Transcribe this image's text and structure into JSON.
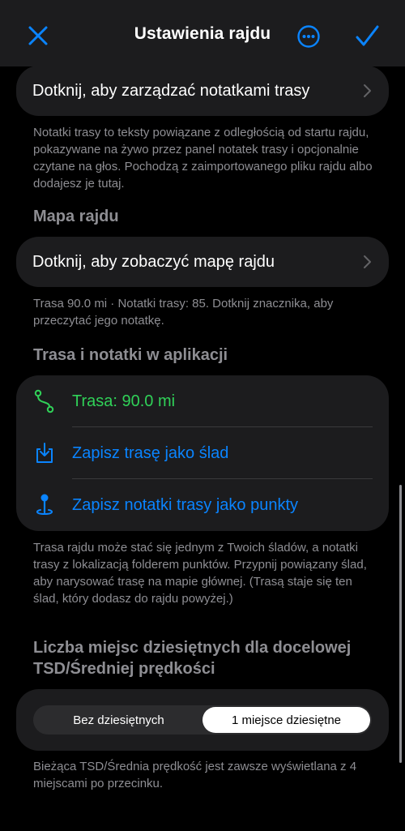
{
  "nav": {
    "title": "Ustawienia rajdu"
  },
  "route_notes": {
    "link_label": "Dotknij, aby zarządzać notatkami trasy",
    "footnote": "Notatki trasy to teksty powiązane z odległością od startu rajdu, pokazywane na żywo przez panel notatek trasy i opcjonalnie czytane na głos. Pochodzą z zaimportowanego pliku rajdu albo dodajesz je tutaj."
  },
  "map": {
    "header": "Mapa rajdu",
    "link_label": "Dotknij, aby zobaczyć mapę rajdu",
    "footnote": "Trasa 90.0 mi · Notatki trasy: 85. Dotknij znacznika, aby przeczytać jego notatkę."
  },
  "app_route": {
    "header": "Trasa i notatki w aplikacji",
    "route_label": "Trasa: 90.0 mi",
    "save_track_label": "Zapisz trasę jako ślad",
    "save_points_label": "Zapisz notatki trasy jako punkty",
    "footnote": "Trasa rajdu może stać się jednym z Twoich śladów, a notatki trasy z lokalizacją folderem punktów. Przypnij powiązany ślad, aby narysować trasę na mapie głównej. (Trasą staje się ten ślad, który dodasz do rajdu powyżej.)"
  },
  "decimals": {
    "header": "Liczba miejsc dziesiętnych dla docelowej TSD/Średniej prędkości",
    "options": [
      "Bez dziesiętnych",
      "1 miejsce dziesiętne"
    ],
    "selected": "1 miejsce dziesiętne",
    "footnote": "Bieżąca TSD/Średnia prędkość jest zawsze wyświetlana z 4 miejscami po przecinku."
  },
  "colors": {
    "accent": "#0a84ff",
    "green": "#30d158",
    "background": "#000000",
    "card": "#1c1c1e",
    "secondary_text": "#8e8e93"
  }
}
